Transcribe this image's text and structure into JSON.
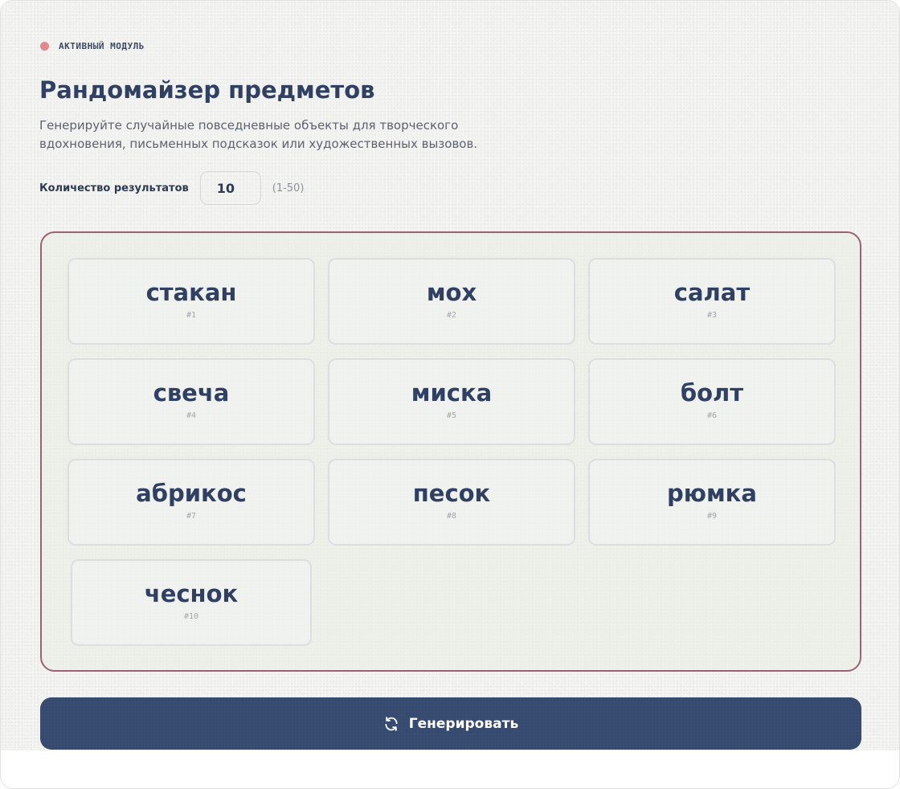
{
  "badge": {
    "text": "АКТИВНЫЙ МОДУЛЬ"
  },
  "header": {
    "title": "Рандомайзер предметов",
    "subtitle": "Генерируйте случайные повседневные объекты для творческого вдохновения, письменных подсказок или художественных вызовов."
  },
  "count": {
    "label": "Количество результатов",
    "value": "10",
    "range": "(1-50)"
  },
  "results": [
    {
      "word": "стакан",
      "num": "#1"
    },
    {
      "word": "мох",
      "num": "#2"
    },
    {
      "word": "салат",
      "num": "#3"
    },
    {
      "word": "свеча",
      "num": "#4"
    },
    {
      "word": "миска",
      "num": "#5"
    },
    {
      "word": "болт",
      "num": "#6"
    },
    {
      "word": "абрикос",
      "num": "#7"
    },
    {
      "word": "песок",
      "num": "#8"
    },
    {
      "word": "рюмка",
      "num": "#9"
    },
    {
      "word": "чеснок",
      "num": "#10"
    }
  ],
  "actions": {
    "generate_label": "Генерировать",
    "generate_icon": "refresh-icon"
  },
  "colors": {
    "accent_dot": "#e08a90",
    "primary": "#354a6e",
    "results_border": "#9a6272"
  }
}
